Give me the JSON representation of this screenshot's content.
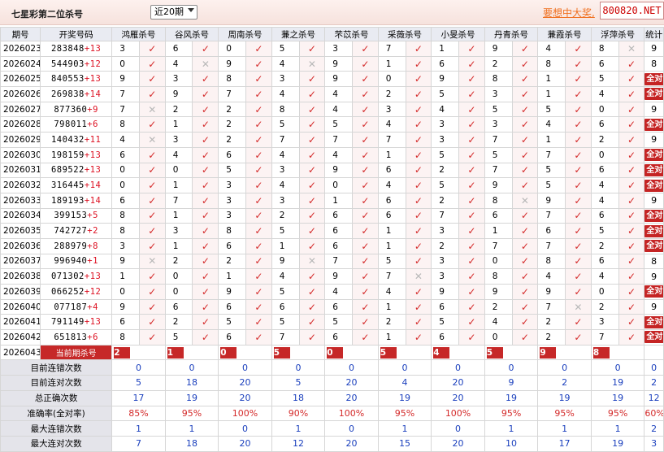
{
  "header": {
    "title": "七星彩第二位杀号",
    "period_select": "近20期",
    "vip_link": "要想中大奖,",
    "site_badge": "800820.NET"
  },
  "columns": {
    "issue": "期号",
    "numbers": "开奖号码",
    "experts": [
      "鸿雁杀号",
      "谷风杀号",
      "周南杀号",
      "蒹之杀号",
      "芣苡杀号",
      "采薇杀号",
      "小旻杀号",
      "丹青杀号",
      "蒹霞杀号",
      "浮萍杀号"
    ],
    "stats": "统计"
  },
  "all_correct_label": "全对",
  "rows": [
    {
      "issue": "2026023",
      "digits": "283848",
      "sum": "+13",
      "vals": [
        "3",
        "6",
        "0",
        "5",
        "3",
        "7",
        "1",
        "9",
        "4",
        "8"
      ],
      "res": [
        1,
        1,
        1,
        1,
        1,
        1,
        1,
        1,
        1,
        0
      ],
      "stat": "9"
    },
    {
      "issue": "2026024",
      "digits": "544903",
      "sum": "+12",
      "vals": [
        "0",
        "4",
        "9",
        "4",
        "9",
        "1",
        "6",
        "2",
        "8",
        "6"
      ],
      "res": [
        1,
        0,
        1,
        0,
        1,
        1,
        1,
        1,
        1,
        1
      ],
      "stat": "8"
    },
    {
      "issue": "2026025",
      "digits": "840553",
      "sum": "+13",
      "vals": [
        "9",
        "3",
        "8",
        "3",
        "9",
        "0",
        "9",
        "8",
        "1",
        "5"
      ],
      "res": [
        1,
        1,
        1,
        1,
        1,
        1,
        1,
        1,
        1,
        1
      ],
      "stat": "全对"
    },
    {
      "issue": "2026026",
      "digits": "269838",
      "sum": "+14",
      "vals": [
        "7",
        "9",
        "7",
        "4",
        "4",
        "2",
        "5",
        "3",
        "1",
        "4"
      ],
      "res": [
        1,
        1,
        1,
        1,
        1,
        1,
        1,
        1,
        1,
        1
      ],
      "stat": "全对"
    },
    {
      "issue": "2026027",
      "digits": "877360",
      "sum": "+9",
      "vals": [
        "7",
        "2",
        "2",
        "8",
        "4",
        "3",
        "4",
        "5",
        "5",
        "0"
      ],
      "res": [
        0,
        1,
        1,
        1,
        1,
        1,
        1,
        1,
        1,
        1
      ],
      "stat": "9"
    },
    {
      "issue": "2026028",
      "digits": "798011",
      "sum": "+6",
      "vals": [
        "8",
        "1",
        "2",
        "5",
        "5",
        "4",
        "3",
        "3",
        "4",
        "6"
      ],
      "res": [
        1,
        1,
        1,
        1,
        1,
        1,
        1,
        1,
        1,
        1
      ],
      "stat": "全对"
    },
    {
      "issue": "2026029",
      "digits": "140432",
      "sum": "+11",
      "vals": [
        "4",
        "3",
        "2",
        "7",
        "7",
        "7",
        "3",
        "7",
        "1",
        "2"
      ],
      "res": [
        0,
        1,
        1,
        1,
        1,
        1,
        1,
        1,
        1,
        1
      ],
      "stat": "9"
    },
    {
      "issue": "2026030",
      "digits": "198159",
      "sum": "+13",
      "vals": [
        "6",
        "4",
        "6",
        "4",
        "4",
        "1",
        "5",
        "5",
        "7",
        "0"
      ],
      "res": [
        1,
        1,
        1,
        1,
        1,
        1,
        1,
        1,
        1,
        1
      ],
      "stat": "全对"
    },
    {
      "issue": "2026031",
      "digits": "689522",
      "sum": "+13",
      "vals": [
        "0",
        "0",
        "5",
        "3",
        "9",
        "6",
        "2",
        "7",
        "5",
        "6"
      ],
      "res": [
        1,
        1,
        1,
        1,
        1,
        1,
        1,
        1,
        1,
        1
      ],
      "stat": "全对"
    },
    {
      "issue": "2026032",
      "digits": "316445",
      "sum": "+14",
      "vals": [
        "0",
        "1",
        "3",
        "4",
        "0",
        "4",
        "5",
        "9",
        "5",
        "4"
      ],
      "res": [
        1,
        1,
        1,
        1,
        1,
        1,
        1,
        1,
        1,
        1
      ],
      "stat": "全对"
    },
    {
      "issue": "2026033",
      "digits": "189193",
      "sum": "+14",
      "vals": [
        "6",
        "7",
        "3",
        "3",
        "1",
        "6",
        "2",
        "8",
        "9",
        "4"
      ],
      "res": [
        1,
        1,
        1,
        1,
        1,
        1,
        1,
        0,
        1,
        1
      ],
      "stat": "9"
    },
    {
      "issue": "2026034",
      "digits": "399153",
      "sum": "+5",
      "vals": [
        "8",
        "1",
        "3",
        "2",
        "6",
        "6",
        "7",
        "6",
        "7",
        "6"
      ],
      "res": [
        1,
        1,
        1,
        1,
        1,
        1,
        1,
        1,
        1,
        1
      ],
      "stat": "全对"
    },
    {
      "issue": "2026035",
      "digits": "742727",
      "sum": "+2",
      "vals": [
        "8",
        "3",
        "8",
        "5",
        "6",
        "1",
        "3",
        "1",
        "6",
        "5"
      ],
      "res": [
        1,
        1,
        1,
        1,
        1,
        1,
        1,
        1,
        1,
        1
      ],
      "stat": "全对"
    },
    {
      "issue": "2026036",
      "digits": "288979",
      "sum": "+8",
      "vals": [
        "3",
        "1",
        "6",
        "1",
        "6",
        "1",
        "2",
        "7",
        "7",
        "2"
      ],
      "res": [
        1,
        1,
        1,
        1,
        1,
        1,
        1,
        1,
        1,
        1
      ],
      "stat": "全对"
    },
    {
      "issue": "2026037",
      "digits": "996940",
      "sum": "+1",
      "vals": [
        "9",
        "2",
        "2",
        "9",
        "7",
        "5",
        "3",
        "0",
        "8",
        "6"
      ],
      "res": [
        0,
        1,
        1,
        0,
        1,
        1,
        1,
        1,
        1,
        1
      ],
      "stat": "8"
    },
    {
      "issue": "2026038",
      "digits": "071302",
      "sum": "+13",
      "vals": [
        "1",
        "0",
        "1",
        "4",
        "9",
        "7",
        "3",
        "8",
        "4",
        "4"
      ],
      "res": [
        1,
        1,
        1,
        1,
        1,
        0,
        1,
        1,
        1,
        1
      ],
      "stat": "9"
    },
    {
      "issue": "2026039",
      "digits": "066252",
      "sum": "+12",
      "vals": [
        "0",
        "0",
        "9",
        "5",
        "4",
        "4",
        "9",
        "9",
        "9",
        "0"
      ],
      "res": [
        1,
        1,
        1,
        1,
        1,
        1,
        1,
        1,
        1,
        1
      ],
      "stat": "全对"
    },
    {
      "issue": "2026040",
      "digits": "077187",
      "sum": "+4",
      "vals": [
        "9",
        "6",
        "6",
        "6",
        "6",
        "1",
        "6",
        "2",
        "7",
        "2"
      ],
      "res": [
        1,
        1,
        1,
        1,
        1,
        1,
        1,
        1,
        0,
        1
      ],
      "stat": "9"
    },
    {
      "issue": "2026041",
      "digits": "791149",
      "sum": "+13",
      "vals": [
        "6",
        "2",
        "5",
        "5",
        "5",
        "2",
        "5",
        "4",
        "2",
        "3"
      ],
      "res": [
        1,
        1,
        1,
        1,
        1,
        1,
        1,
        1,
        1,
        1
      ],
      "stat": "全对"
    },
    {
      "issue": "2026042",
      "digits": "651813",
      "sum": "+6",
      "vals": [
        "8",
        "5",
        "6",
        "7",
        "6",
        "1",
        "6",
        "0",
        "2",
        "7"
      ],
      "res": [
        1,
        1,
        1,
        1,
        1,
        1,
        1,
        1,
        1,
        1
      ],
      "stat": "全对"
    }
  ],
  "current": {
    "issue": "2026043",
    "label": "当前期杀号",
    "vals": [
      "2",
      "1",
      "0",
      "5",
      "0",
      "5",
      "4",
      "5",
      "9",
      "8"
    ]
  },
  "footer": [
    {
      "label": "目前连错次数",
      "vals": [
        "0",
        "0",
        "0",
        "0",
        "0",
        "0",
        "0",
        "0",
        "0",
        "0"
      ],
      "stat": "0",
      "red": false
    },
    {
      "label": "目前连对次数",
      "vals": [
        "5",
        "18",
        "20",
        "5",
        "20",
        "4",
        "20",
        "9",
        "2",
        "19"
      ],
      "stat": "2",
      "red": false
    },
    {
      "label": "总正确次数",
      "vals": [
        "17",
        "19",
        "20",
        "18",
        "20",
        "19",
        "20",
        "19",
        "19",
        "19"
      ],
      "stat": "12",
      "red": false
    },
    {
      "label": "准确率(全对率)",
      "vals": [
        "85%",
        "95%",
        "100%",
        "90%",
        "100%",
        "95%",
        "100%",
        "95%",
        "95%",
        "95%"
      ],
      "stat": "60%",
      "red": true
    },
    {
      "label": "最大连错次数",
      "vals": [
        "1",
        "1",
        "0",
        "1",
        "0",
        "1",
        "0",
        "1",
        "1",
        "1"
      ],
      "stat": "2",
      "red": false
    },
    {
      "label": "最大连对次数",
      "vals": [
        "7",
        "18",
        "20",
        "12",
        "20",
        "15",
        "20",
        "10",
        "17",
        "19"
      ],
      "stat": "3",
      "red": false
    }
  ],
  "icons": {
    "correct": "check-icon",
    "wrong": "cross-icon"
  },
  "colors": {
    "accent": "#d42a2a",
    "blue": "#1a3fbd",
    "header_bg": "#e9ebf2"
  }
}
